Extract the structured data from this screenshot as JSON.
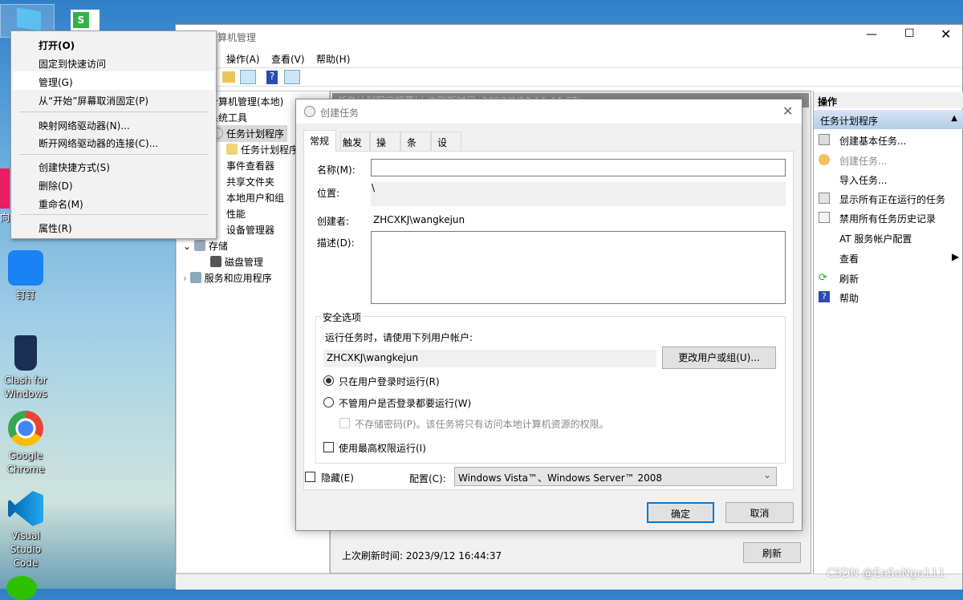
{
  "desktop": {
    "icons": [
      {
        "label": "钉钉",
        "icon": "dingtalk-icon"
      },
      {
        "label": "Clash for Windows",
        "icon": "clash-icon"
      },
      {
        "label": "Google Chrome",
        "icon": "chrome-icon"
      },
      {
        "label": "Visual Studio Code",
        "icon": "vscode-icon"
      }
    ],
    "partial_label": "向日"
  },
  "context_menu": {
    "items": [
      "打开(O)",
      "固定到快速访问",
      "管理(G)",
      "从“开始”屏幕取消固定(P)",
      "映射网络驱动器(N)...",
      "断开网络驱动器的连接(C)...",
      "创建快捷方式(S)",
      "删除(D)",
      "重命名(M)",
      "属性(R)"
    ],
    "highlighted": "管理(G)"
  },
  "window": {
    "title": "计算机管理",
    "menu": [
      "操作(A)",
      "查看(V)",
      "帮助(H)"
    ],
    "tree": [
      "计算机管理(本地)",
      "系统工具",
      "任务计划程序",
      "任务计划程序库",
      "事件查看器",
      "共享文件夹",
      "本地用户和组",
      "性能",
      "设备管理器",
      "存储",
      "磁盘管理",
      "服务和应用程序"
    ],
    "center": {
      "header": "任务计划程序摘要(上次刷新时间: 2023/9/12 16:44:37)",
      "last_refresh": "上次刷新时间: 2023/9/12 16:44:37",
      "refresh_button": "刷新"
    },
    "actions": {
      "header": "操作",
      "section": "任务计划程序",
      "items": [
        "创建基本任务...",
        "创建任务...",
        "导入任务...",
        "显示所有正在运行的任务",
        "禁用所有任务历史记录",
        "AT 服务帐户配置",
        "查看",
        "刷新",
        "帮助"
      ]
    }
  },
  "dialog": {
    "title": "创建任务",
    "tabs": [
      "常规",
      "触发器",
      "操作",
      "条件",
      "设置"
    ],
    "active_tab": "常规",
    "name_label": "名称(M):",
    "name_value": "",
    "location_label": "位置:",
    "location_value": "\\",
    "author_label": "创建者:",
    "author_value": "ZHCXKJ\\wangkejun",
    "desc_label": "描述(D):",
    "desc_value": "",
    "security": {
      "title": "安全选项",
      "prompt": "运行任务时，请使用下列用户帐户:",
      "account": "ZHCXKJ\\wangkejun",
      "change_button": "更改用户或组(U)...",
      "radio_logged_on": "只在用户登录时运行(R)",
      "radio_always": "不管用户是否登录都要运行(W)",
      "selected": "只在用户登录时运行(R)",
      "no_store_password": "不存储密码(P)。该任务将只有访问本地计算机资源的权限。",
      "highest_priv": "使用最高权限运行(I)",
      "highest_priv_checked": false
    },
    "hidden_label": "隐藏(E)",
    "hidden_checked": false,
    "config_label": "配置(C):",
    "config_value": "Windows Vista™、Windows Server™ 2008",
    "ok": "确定",
    "cancel": "取消"
  },
  "watermark": "CSDN @EaSoNgo111"
}
